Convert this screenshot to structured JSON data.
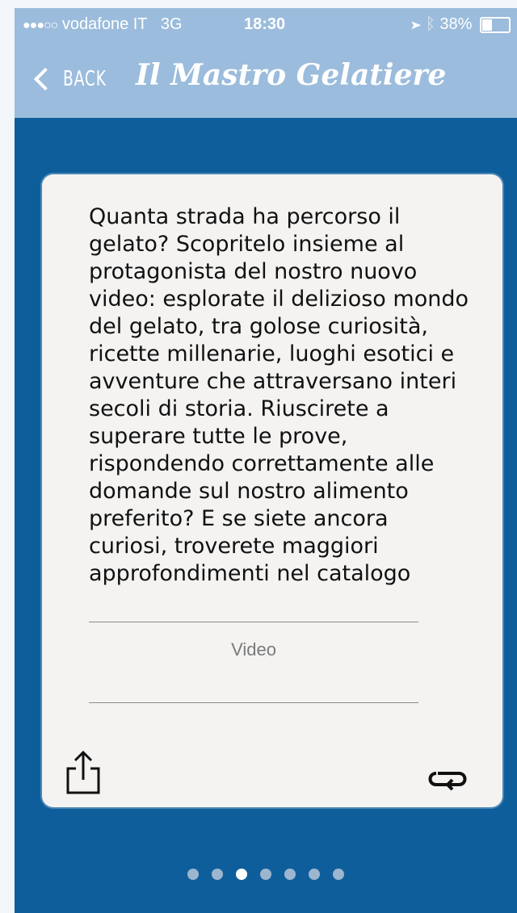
{
  "statusbar": {
    "signal": "●●●○○",
    "carrier": "vodafone IT",
    "network": "3G",
    "time": "18:30",
    "battery": "38%"
  },
  "navbar": {
    "back_label": "BACK",
    "title": "Il Mastro Gelatiere"
  },
  "card": {
    "description": "Quanta strada ha percorso il gelato? Scopritelo insieme al protagonista del nostro nuovo video: esplorate il delizioso mondo del gelato, tra golose curiosità, ricette millenarie, luoghi esotici e avventure che attraversano interi secoli di storia. Riuscirete a superare tutte le prove, rispondendo correttamente alle domande sul nostro alimento preferito? E se siete ancora curiosi, troverete maggiori approfondimenti nel catalogo",
    "video_label": "Video",
    "share_icon": "share-icon",
    "loop_icon": "loop-icon"
  },
  "pager": {
    "count": 7,
    "active_index": 2
  },
  "colors": {
    "background_blue": "#0f5e9c",
    "bar_light_blue": "#9bbcdc",
    "card": "#f4f3f2"
  }
}
